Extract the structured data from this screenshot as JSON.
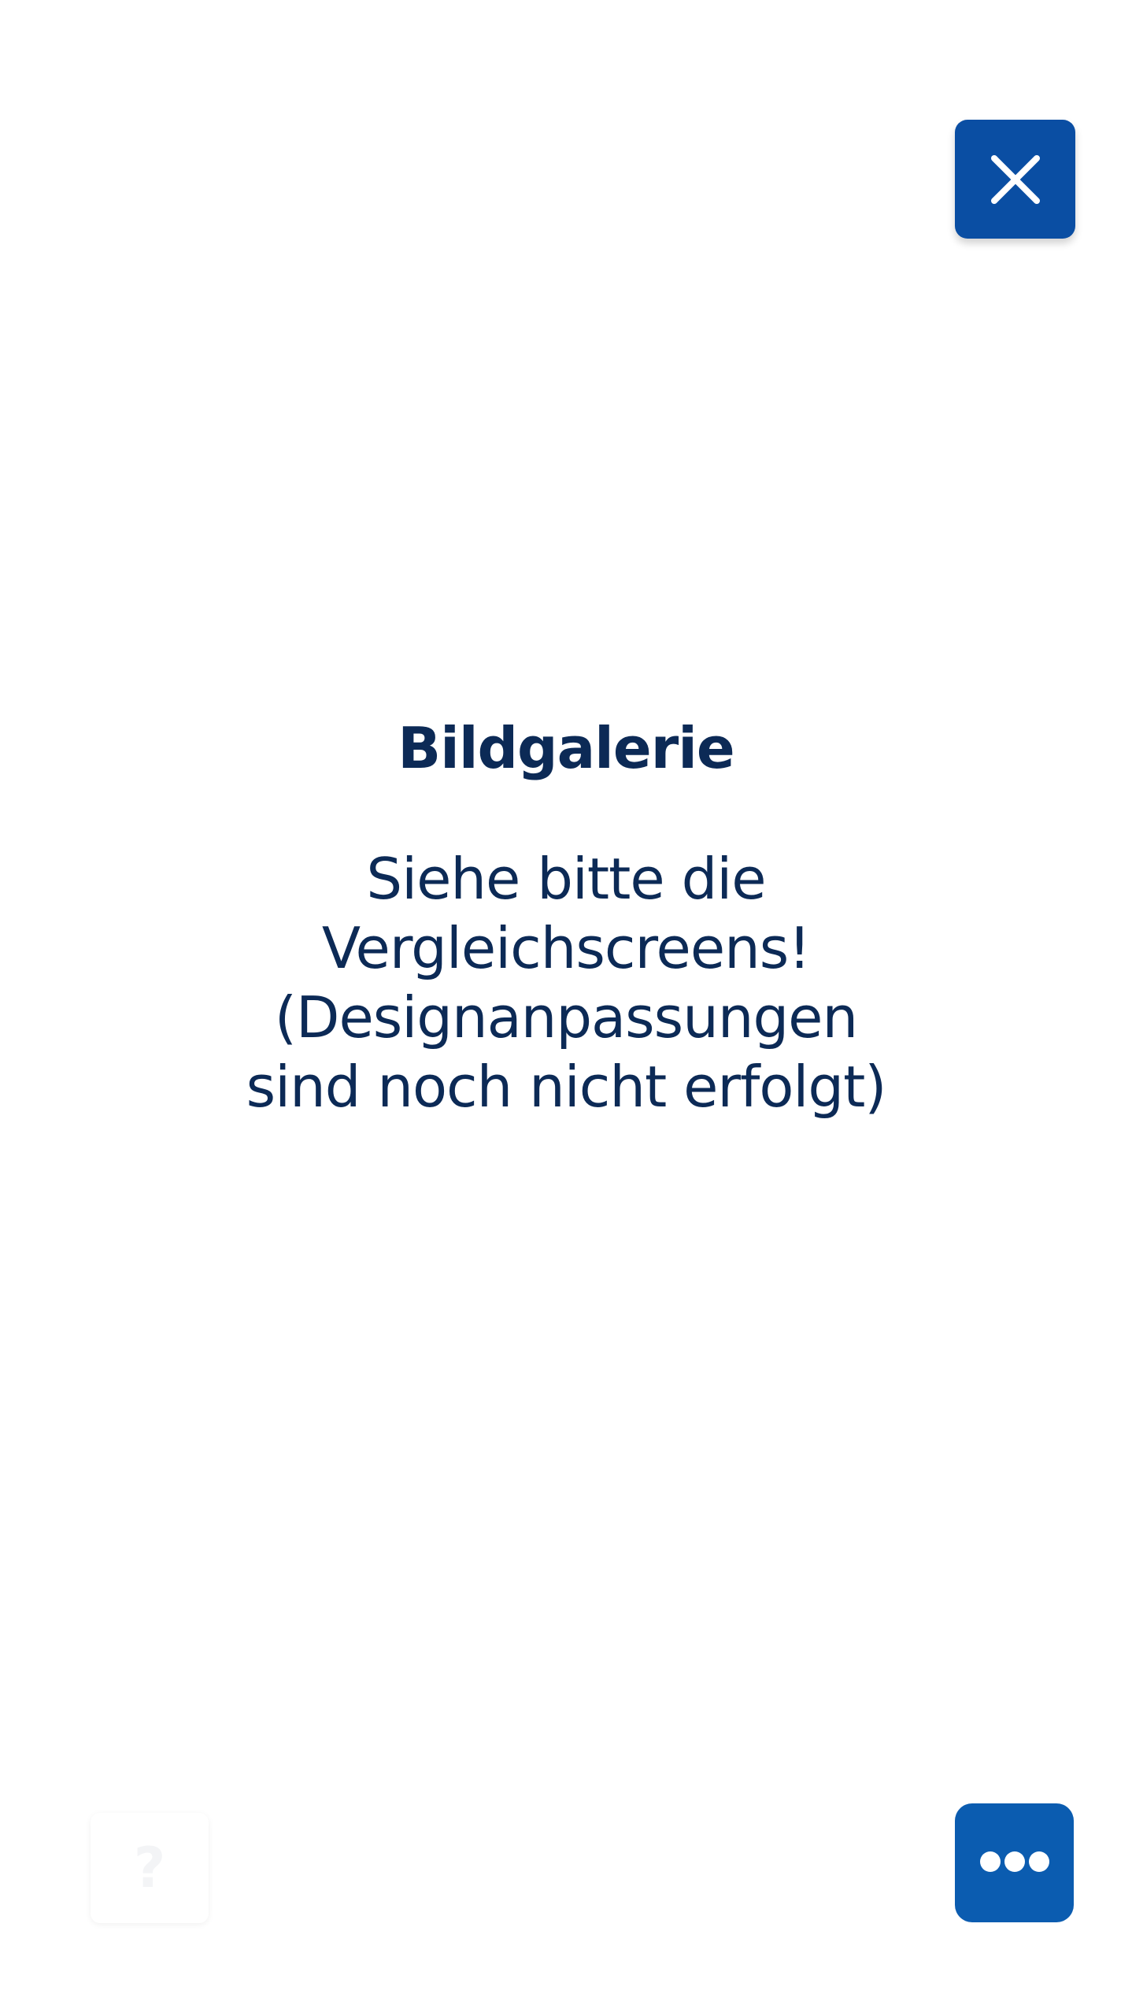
{
  "colors": {
    "primary": "#0a4ea3",
    "more_button": "#0b5cb0",
    "text": "#0c2a56",
    "background": "#ffffff"
  },
  "header": {
    "close_icon": "close-icon"
  },
  "main": {
    "title": "Bildgalerie",
    "message": "Siehe bitte die\nVergleichscreens!\n(Designanpassungen\nsind noch nicht erfolgt)"
  },
  "footer": {
    "help_label": "?",
    "help_icon": "question-icon",
    "more_icon": "more-dots-icon"
  }
}
